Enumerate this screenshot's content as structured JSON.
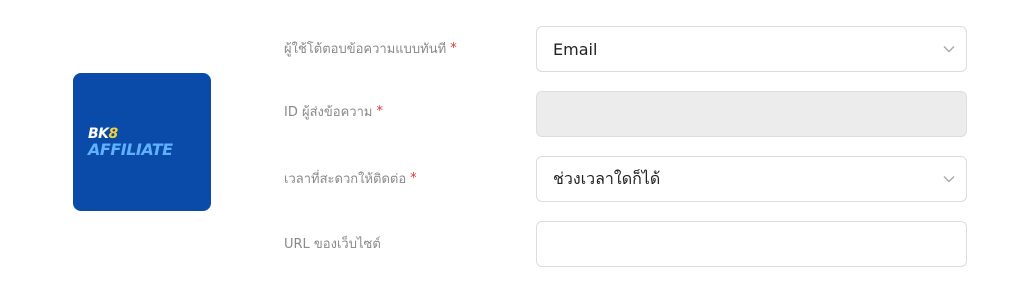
{
  "logo": {
    "line1_a": "BK",
    "line1_b": "8",
    "line2": "AFFILIATE"
  },
  "form": {
    "required_mark": "*",
    "fields": [
      {
        "label": "ผู้ใช้โต้ตอบข้อความแบบทันที",
        "value": "Email",
        "type": "select"
      },
      {
        "label": "ID ผู้ส่งข้อความ",
        "value": "",
        "type": "text-disabled"
      },
      {
        "label": "เวลาที่สะดวกให้ติดต่อ",
        "value": "ช่วงเวลาใดก็ได้",
        "type": "select"
      },
      {
        "label": "URL ของเว็บไซต์",
        "value": "",
        "type": "text"
      }
    ]
  },
  "icons": {
    "select_arrow": "chevron-down-icon"
  }
}
